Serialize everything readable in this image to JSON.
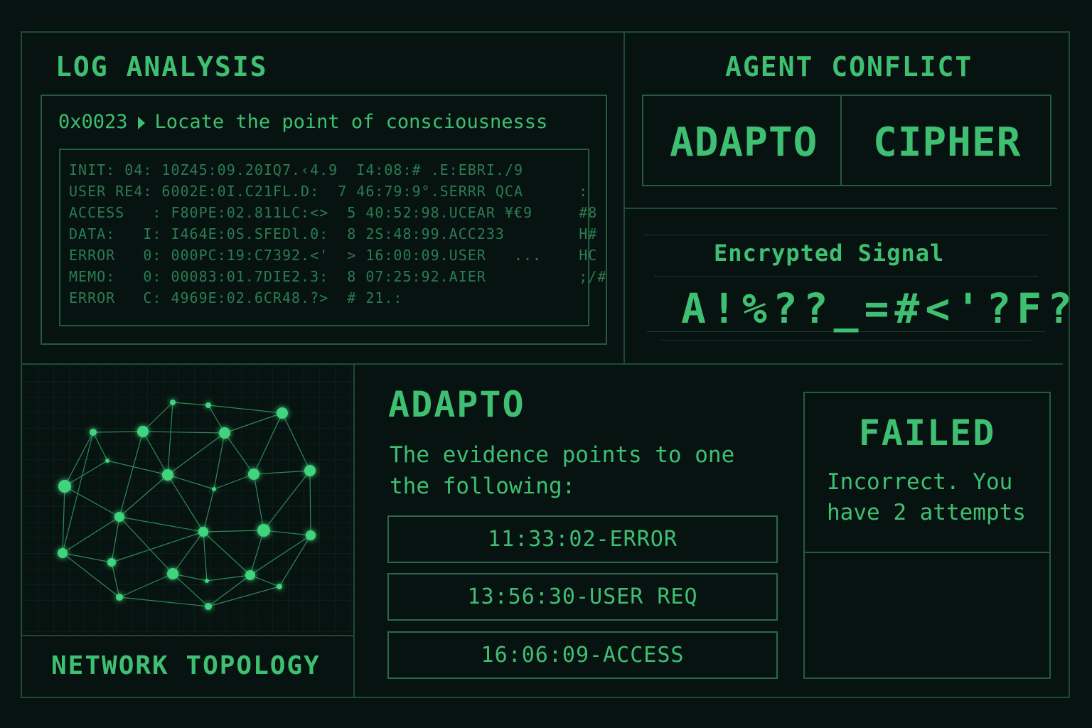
{
  "log_analysis": {
    "title": "LOG ANALYSIS",
    "prompt_code": "0x0023",
    "prompt_text": "Locate the point of consciousnesss",
    "lines": [
      "INIT: 04: 10Z45:09.20IQ7.‹4.9  I4:08:# .E:EBRI./9",
      "USER RE4: 6002E:0I.C21FL.D:  7 46:79:9°.SERRR QCA      :",
      "ACCESS   : F80PE:02.811LC:<>  5 40:52:98.UCEAR ¥€9     #8",
      "DATA:   I: I464E:0S.SFEDl.0:  8 2S:48:99.ACC233        H#",
      "ERROR   0: 000PC:19:C7392.<'  > 16:00:09.USER   ...    HC",
      "MEMO:   0: 00083:01.7DIE2.3:  8 07:25:92.AIER          ;/#",
      "ERROR   C: 4969E:02.6CR48.?>  # 21.:"
    ]
  },
  "agent_conflict": {
    "title": "AGENT CONFLICT",
    "agents": [
      "ADAPTO",
      "CIPHER"
    ],
    "signal_label": "Encrypted Signal",
    "signal_code": "A!%??_=#<'?F?"
  },
  "network": {
    "title": "NETWORK TOPOLOGY"
  },
  "question": {
    "agent": "ADAPTO",
    "text": "The evidence points to one the following:",
    "options": [
      "11:33:02-ERROR",
      "13:56:30-USER REQ",
      "16:06:09-ACCESS"
    ]
  },
  "result": {
    "status": "FAILED",
    "message": "Incorrect. You have 2 attempts"
  },
  "colors": {
    "background": "#071310",
    "accent": "#3fbf72",
    "border": "#245a3e"
  }
}
